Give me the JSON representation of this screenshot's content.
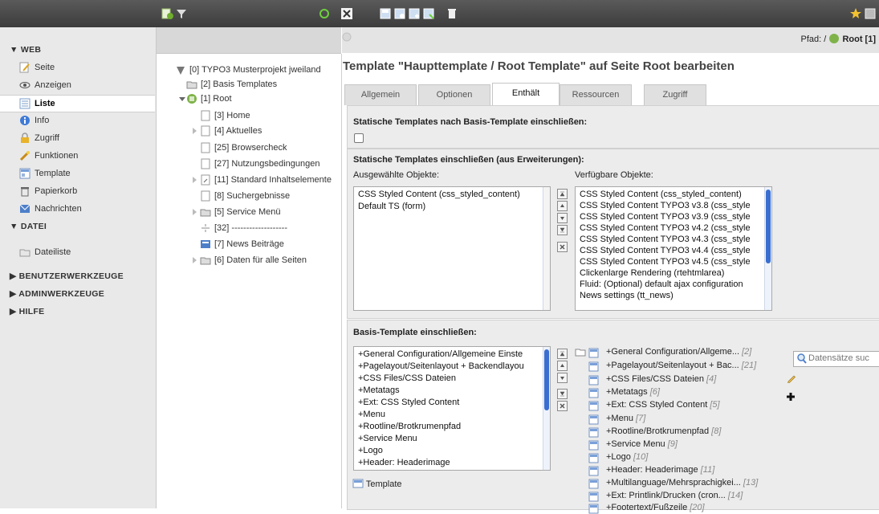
{
  "menu": {
    "groups": [
      {
        "title": "WEB",
        "items": [
          {
            "label": "Seite",
            "icon": "page-edit-icon"
          },
          {
            "label": "Anzeigen",
            "icon": "eye-icon"
          },
          {
            "label": "Liste",
            "icon": "list-icon"
          },
          {
            "label": "Info",
            "icon": "info-icon"
          },
          {
            "label": "Zugriff",
            "icon": "lock-icon"
          },
          {
            "label": "Funktionen",
            "icon": "wand-icon"
          },
          {
            "label": "Template",
            "icon": "template-icon"
          },
          {
            "label": "Papierkorb",
            "icon": "trash-icon"
          },
          {
            "label": "Nachrichten",
            "icon": "messages-icon"
          }
        ]
      },
      {
        "title": "DATEI",
        "items": [
          {
            "label": "Dateiliste",
            "icon": "folder-icon"
          }
        ]
      },
      {
        "title": "BENUTZERWERKZEUGE",
        "items": []
      },
      {
        "title": "ADMINWERKZEUGE",
        "items": []
      },
      {
        "title": "HILFE",
        "items": []
      }
    ],
    "active_item": "Liste"
  },
  "tree": {
    "nodes": [
      "[0] TYPO3 Musterprojekt jweiland",
      "[2] Basis Templates",
      "[1] Root",
      "[3] Home",
      "[4] Aktuelles",
      "[25] Browsercheck",
      "[27] Nutzungsbedingungen",
      "[11] Standard Inhaltselemente",
      "[8] Suchergebnisse",
      "[5] Service Menü",
      "[32] -------------------",
      "[7] News Beiträge",
      "[6] Daten für alle Seiten"
    ]
  },
  "docheader": {
    "path_label": "Pfad: /",
    "path_value": "Root [1]"
  },
  "main": {
    "title": "Template \"Haupttemplate / Root Template\" auf Seite Root bearbeiten",
    "tabs": [
      "Allgemein",
      "Optionen",
      "Enthält",
      "Ressourcen",
      "Zugriff"
    ],
    "active_tab": "Enthält",
    "static_basis_label": "Statische Templates nach Basis-Template einschließen:",
    "static_ext_label": "Statische Templates einschließen (aus Erweiterungen):",
    "selected_label": "Ausgewählte Objekte:",
    "available_label": "Verfügbare Objekte:",
    "selected_items": [
      "CSS Styled Content (css_styled_content)",
      "Default TS (form)"
    ],
    "available_items": [
      "CSS Styled Content (css_styled_content)",
      "CSS Styled Content TYPO3 v3.8 (css_style",
      "CSS Styled Content TYPO3 v3.9 (css_style",
      "CSS Styled Content TYPO3 v4.2 (css_style",
      "CSS Styled Content TYPO3 v4.3 (css_style",
      "CSS Styled Content TYPO3 v4.4 (css_style",
      "CSS Styled Content TYPO3 v4.5 (css_style",
      "Clickenlarge Rendering (rtehtmlarea)",
      "Fluid: (Optional) default ajax configuration",
      "News settings (tt_news)"
    ],
    "basis_label": "Basis-Template einschließen:",
    "basis_items": [
      "+General Configuration/Allgemeine Einste",
      "+Pagelayout/Seitenlayout + Backendlayou",
      "+CSS Files/CSS Dateien",
      "+Metatags",
      "+Ext: CSS Styled Content",
      "+Menu",
      "+Rootline/Brotkrumenpfad",
      "+Service Menu",
      "+Logo",
      "+Header: Headerimage"
    ],
    "template_link": "Template",
    "records": [
      {
        "label": "+General Configuration/Allgeme...",
        "id": "[2]"
      },
      {
        "label": "+Pagelayout/Seitenlayout + Bac...",
        "id": "[21]"
      },
      {
        "label": "+CSS Files/CSS Dateien",
        "id": "[4]"
      },
      {
        "label": "+Metatags",
        "id": "[6]"
      },
      {
        "label": "+Ext: CSS Styled Content",
        "id": "[5]"
      },
      {
        "label": "+Menu",
        "id": "[7]"
      },
      {
        "label": "+Rootline/Brotkrumenpfad",
        "id": "[8]"
      },
      {
        "label": "+Service Menu",
        "id": "[9]"
      },
      {
        "label": "+Logo",
        "id": "[10]"
      },
      {
        "label": "+Header: Headerimage",
        "id": "[11]"
      },
      {
        "label": "+Multilanguage/Mehrsprachigkei...",
        "id": "[13]"
      },
      {
        "label": "+Ext: Printlink/Drucken (cron...",
        "id": "[14]"
      },
      {
        "label": "+Footertext/Fußzeile",
        "id": "[20]"
      }
    ],
    "search_placeholder": "Datensätze suc"
  }
}
